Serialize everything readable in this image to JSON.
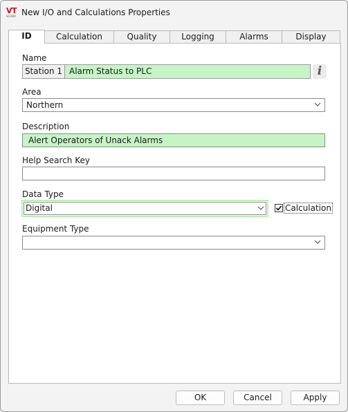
{
  "window": {
    "title": "New I/O and Calculations Properties",
    "app_icon": "vtscada-logo"
  },
  "tabs": [
    {
      "label": "ID",
      "active": true
    },
    {
      "label": "Calculation",
      "active": false
    },
    {
      "label": "Quality",
      "active": false
    },
    {
      "label": "Logging",
      "active": false
    },
    {
      "label": "Alarms",
      "active": false
    },
    {
      "label": "Display",
      "active": false
    }
  ],
  "name": {
    "label": "Name",
    "prefix": "Station 1",
    "value": "Alarm Status to PLC",
    "info_icon": "info-icon"
  },
  "area": {
    "label": "Area",
    "value": "Northern"
  },
  "description": {
    "label": "Description",
    "value": "Alert Operators of Unack Alarms"
  },
  "help_search_key": {
    "label": "Help Search Key",
    "value": ""
  },
  "data_type": {
    "label": "Data Type",
    "value": "Digital",
    "calculation_checkbox_label": "Calculation",
    "calculation_checked": true
  },
  "equipment_type": {
    "label": "Equipment Type",
    "value": ""
  },
  "buttons": {
    "ok": "OK",
    "cancel": "Cancel",
    "apply": "Apply"
  },
  "colors": {
    "highlight_field": "#c5f5c5",
    "focus_border": "#b8f0b8",
    "logo_red": "#c0141c"
  }
}
